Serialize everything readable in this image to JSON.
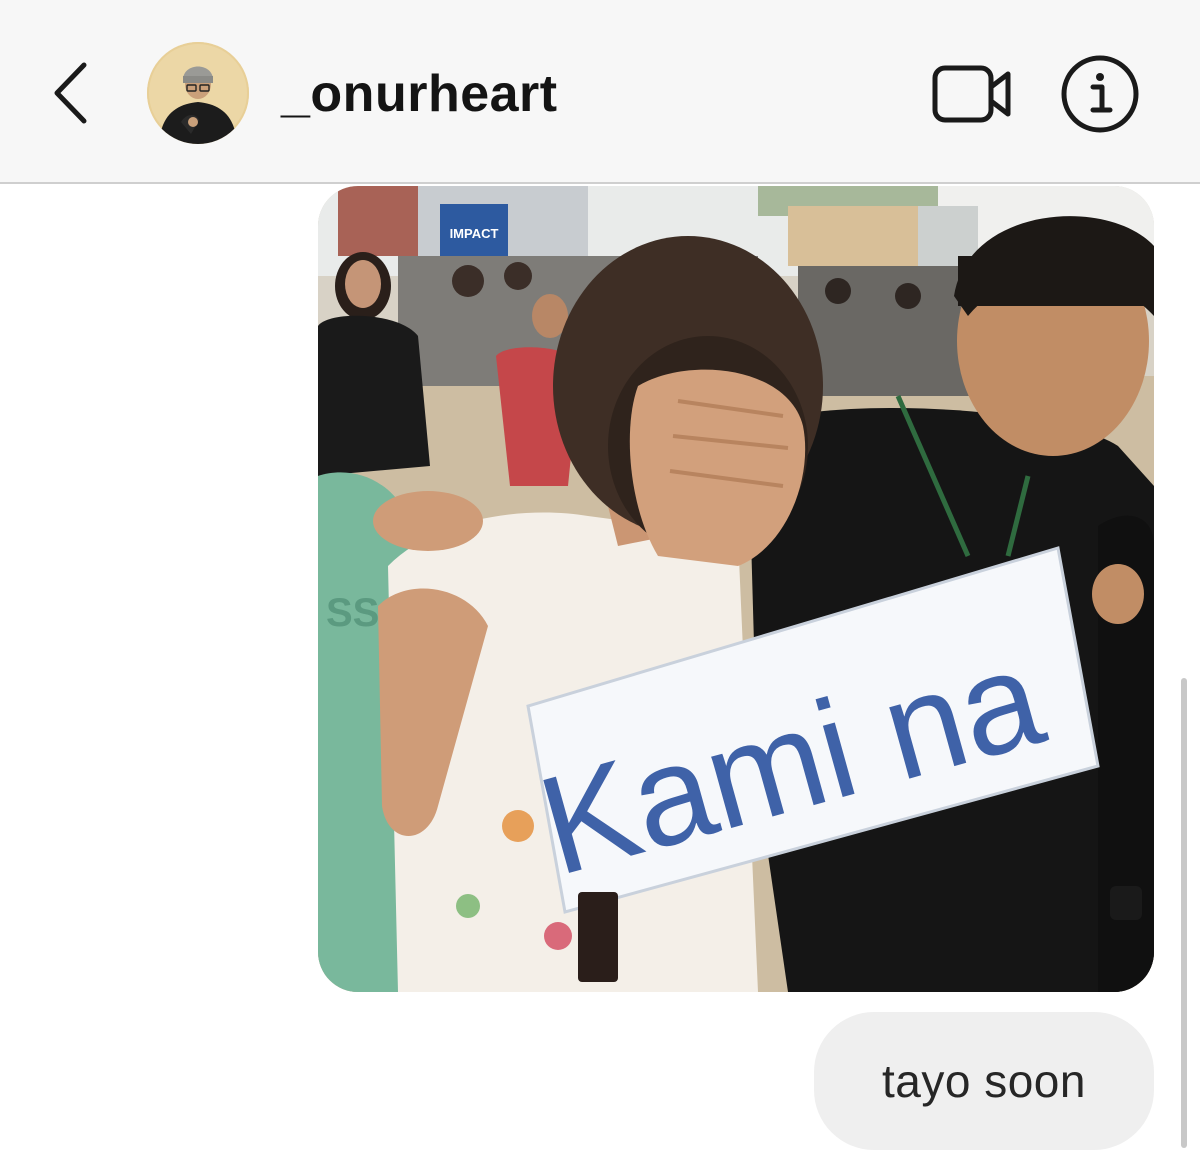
{
  "header": {
    "username": "_onurheart",
    "back_icon": "chevron-left-icon",
    "video_icon": "video-camera-icon",
    "info_icon": "info-icon"
  },
  "messages": [
    {
      "type": "photo",
      "sign_text": "Kami na",
      "banner_text": "IMPACT"
    },
    {
      "type": "text",
      "text": "tayo soon"
    }
  ],
  "colors": {
    "header_bg": "#f7f7f7",
    "bubble_bg": "#efefef",
    "sign_text": "#3f62a8"
  }
}
